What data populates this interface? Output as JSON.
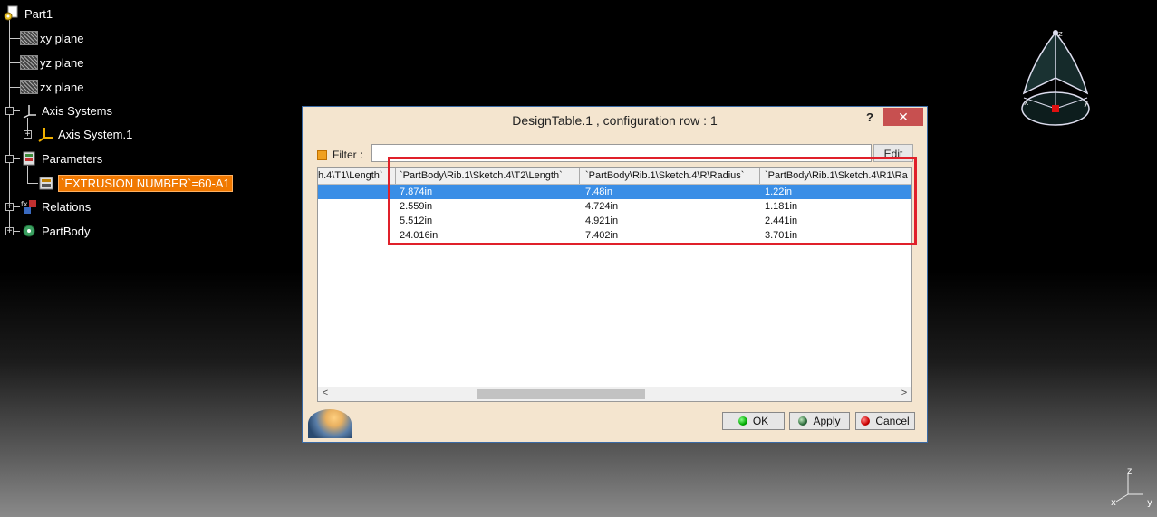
{
  "tree": {
    "root": "Part1",
    "items": [
      {
        "label": "xy plane"
      },
      {
        "label": "yz plane"
      },
      {
        "label": "zx plane"
      },
      {
        "label": "Axis Systems"
      },
      {
        "label": "Axis System.1"
      },
      {
        "label": "Parameters"
      },
      {
        "label": "`EXTRUSION NUMBER`=60-A1"
      },
      {
        "label": "Relations"
      },
      {
        "label": "PartBody"
      }
    ]
  },
  "compass": {
    "z": "z",
    "x": "x",
    "y": "y"
  },
  "axes_triad": {
    "z": "z",
    "x": "x",
    "y": "y"
  },
  "dialog": {
    "title": "DesignTable.1 , configuration row : 1",
    "help": "?",
    "close": "✕",
    "filter_label": "Filter :",
    "filter_value": "",
    "edit_label": "Edit",
    "columns": [
      "h.4\\T1\\Length`",
      "`PartBody\\Rib.1\\Sketch.4\\T2\\Length`",
      "`PartBody\\Rib.1\\Sketch.4\\R\\Radius`",
      "`PartBody\\Rib.1\\Sketch.4\\R1\\Ra"
    ],
    "rows": [
      [
        "",
        "7.874in",
        "7.48in",
        "1.22in"
      ],
      [
        "",
        "2.559in",
        "4.724in",
        "1.181in"
      ],
      [
        "",
        "5.512in",
        "4.921in",
        "2.441in"
      ],
      [
        "",
        "24.016in",
        "7.402in",
        "3.701in"
      ]
    ],
    "selected_row": 1,
    "scroll_left": "<",
    "scroll_right": ">",
    "ok_label": "OK",
    "apply_label": "Apply",
    "cancel_label": "Cancel"
  },
  "colors": {
    "selection": "#3a8ee6",
    "highlight_box": "#e0202a",
    "tree_selection": "#f07800"
  }
}
